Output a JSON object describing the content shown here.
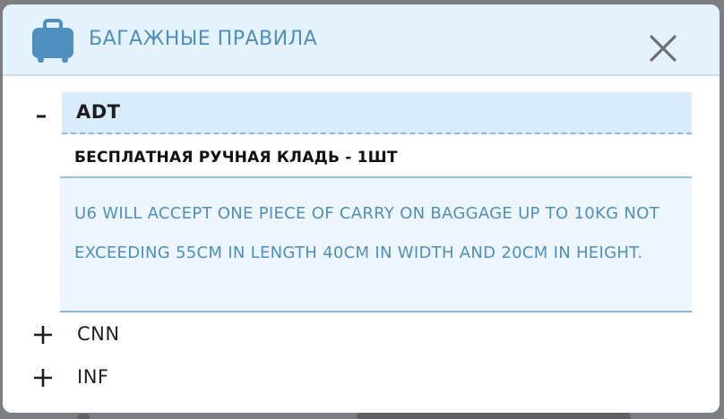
{
  "modal": {
    "title": "БАГАЖНЫЕ ПРАВИЛА",
    "icons": {
      "header": "suitcase-icon",
      "close": "close-icon",
      "collapse": "minus-icon",
      "expand": "plus-icon"
    },
    "colors": {
      "header_bg": "#e3f2fd",
      "accent": "#4f8fc0",
      "group_bg": "#d9ecfc",
      "panel_bg": "#edf6fe"
    }
  },
  "passengers": [
    {
      "code": "ADT",
      "expanded": true,
      "toggle": "–",
      "rules": [
        {
          "title": "БЕСПЛАТНАЯ РУЧНАЯ КЛАДЬ - 1ШТ",
          "description": "U6 WILL ACCEPT ONE PIECE OF CARRY ON BAGGAGE UP TO 10KG NOT EXCEEDING 55CM IN LENGTH 40CM IN WIDTH AND 20CM IN HEIGHT."
        }
      ]
    },
    {
      "code": "CNN",
      "expanded": false,
      "toggle": "+"
    },
    {
      "code": "INF",
      "expanded": false,
      "toggle": "+"
    }
  ]
}
